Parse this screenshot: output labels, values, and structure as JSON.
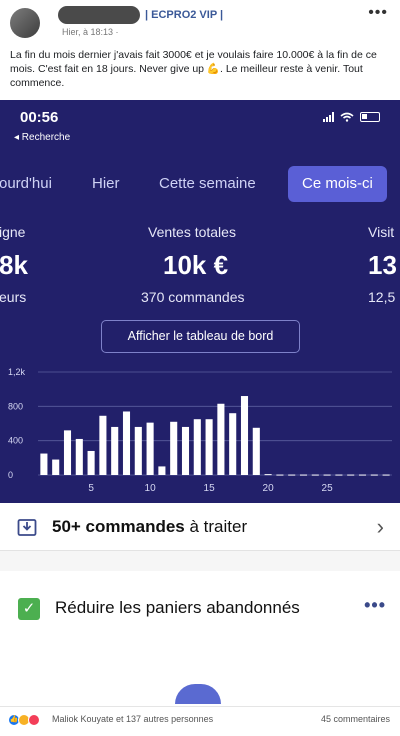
{
  "post": {
    "group": "| ECPRO2 VIP |",
    "time": "Hier, à 18:13 · ",
    "text": "La fin du mois dernier j'avais fait 3000€ et je voulais faire 10.000€ à la fin de ce mois. C'est fait en 18 jours. Never give up 💪. Le meilleur reste à venir. Tout commence."
  },
  "status": {
    "time": "00:56",
    "back": "◂ Recherche"
  },
  "tabs": [
    "ourd'hui",
    "Hier",
    "Cette semaine",
    "Ce mois-ci"
  ],
  "stats": {
    "left_label": "igne",
    "left_value": "8k",
    "left_sub": "eurs",
    "center_label": "Ventes totales",
    "center_value": "10k €",
    "center_sub": "370 commandes",
    "right_label": "Visit",
    "right_value": "13",
    "right_sub": "12,5"
  },
  "dashboard_button": "Afficher le tableau de bord",
  "chart_data": {
    "type": "bar",
    "x": [
      1,
      2,
      3,
      4,
      5,
      6,
      7,
      8,
      9,
      10,
      11,
      12,
      13,
      14,
      15,
      16,
      17,
      18,
      19,
      20,
      21,
      22,
      23,
      24,
      25,
      26,
      27,
      28,
      29,
      30
    ],
    "values": [
      250,
      180,
      520,
      420,
      280,
      690,
      560,
      740,
      560,
      610,
      100,
      620,
      560,
      650,
      650,
      830,
      720,
      920,
      550,
      10,
      5,
      5,
      5,
      5,
      5,
      5,
      5,
      5,
      5,
      5
    ],
    "x_ticks": [
      "5",
      "10",
      "15",
      "20",
      "25"
    ],
    "x_tick_values": [
      5,
      10,
      15,
      20,
      25
    ],
    "y_ticks": [
      "0",
      "400",
      "800",
      "1,2k"
    ],
    "y_tick_values": [
      0,
      400,
      800,
      1200
    ],
    "ylim": [
      0,
      1200
    ],
    "grid": true,
    "bar_color": "#ffffff"
  },
  "todo": {
    "count": "50+ commandes",
    "rest": " à traiter"
  },
  "card": {
    "title": "Réduire les paniers abandonnés",
    "more": "•••"
  },
  "reactions": {
    "names": "Maliok Kouyate et 137 autres personnes",
    "comments": "45 commentaires"
  },
  "colors": {
    "panel": "#22206a",
    "active_tab": "#5a5fd6",
    "check": "#4caf50"
  }
}
